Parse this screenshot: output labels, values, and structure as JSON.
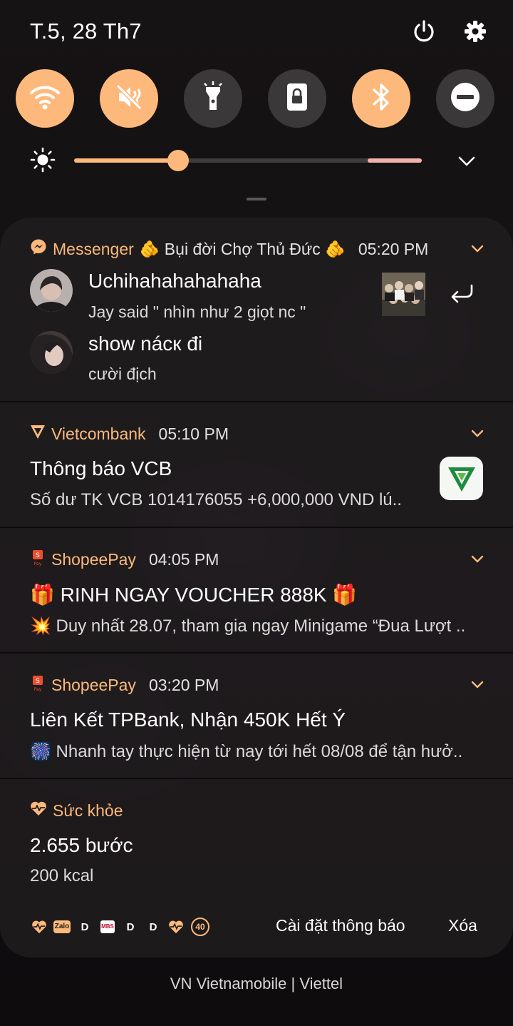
{
  "status": {
    "date": "T.5, 28 Th7"
  },
  "quick_settings": {
    "toggles": [
      {
        "name": "wifi",
        "on": true
      },
      {
        "name": "sound-mute",
        "on": true
      },
      {
        "name": "flashlight",
        "on": false
      },
      {
        "name": "screen-lock",
        "on": false
      },
      {
        "name": "bluetooth",
        "on": true
      },
      {
        "name": "do-not-disturb",
        "on": false
      }
    ],
    "brightness": 0.3
  },
  "notifications": {
    "messenger": {
      "app": "Messenger",
      "subtitle": "🫵 Bụi đời Chợ Thủ Đức 🫵",
      "time": "05:20 PM",
      "messages": [
        {
          "sender": "Uchihahahahahaha",
          "text": "Jay said \" nhìn như 2 giọt nc \""
        },
        {
          "sender": "show nácк đi",
          "text": "cười địch"
        }
      ]
    },
    "vcb": {
      "app": "Vietcombank",
      "time": "05:10 PM",
      "title": "Thông báo VCB",
      "text": "Số dư TK VCB 1014176055 +6,000,000 VND lú.."
    },
    "shopee1": {
      "app": "ShopeePay",
      "time": "04:05 PM",
      "title": "🎁 RINH NGAY VOUCHER 888K 🎁",
      "text": "💥 Duy nhất 28.07, tham gia ngay Minigame “Đua Lượt .."
    },
    "shopee2": {
      "app": "ShopeePay",
      "time": "03:20 PM",
      "title": "Liên Kết TPBank, Nhận 450K Hết Ý",
      "text": "🎆 Nhanh tay thực hiện từ nay tới hết 08/08 để tận hưở.."
    },
    "health": {
      "app": "Sức khỏe",
      "title": "2.655 bước",
      "text": "200 kcal"
    }
  },
  "bottom_bar": {
    "mini_icons": {
      "zalo": "Zalo",
      "d": "D",
      "mbs": "MBS",
      "badge": "40"
    },
    "settings_label": "Cài đặt thông báo",
    "clear_label": "Xóa"
  },
  "carrier": "VN Vietnamobile | Viettel",
  "colors": {
    "accent": "#fdb97b",
    "panel": "#201d1f"
  }
}
